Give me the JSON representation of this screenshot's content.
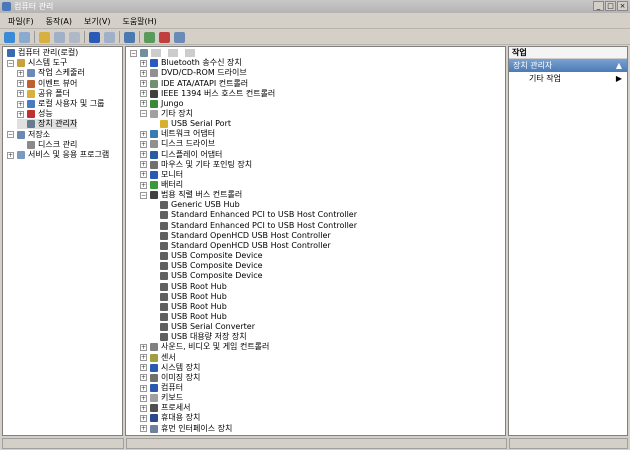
{
  "window": {
    "title": "컴퓨터 관리",
    "controls": [
      "_",
      "□",
      "×"
    ]
  },
  "menu": [
    "파일(F)",
    "동작(A)",
    "보기(V)",
    "도움말(H)"
  ],
  "left_tree": [
    {
      "label": "컴퓨터 관리(로컬)",
      "level": 0,
      "exp": "",
      "color": "#3a6ab0"
    },
    {
      "label": "시스템 도구",
      "level": 1,
      "exp": "−",
      "color": "#c8a040"
    },
    {
      "label": "작업 스케줄러",
      "level": 2,
      "exp": "+",
      "color": "#6a8ab8"
    },
    {
      "label": "이벤트 뷰어",
      "level": 2,
      "exp": "+",
      "color": "#c06030"
    },
    {
      "label": "공유 폴더",
      "level": 2,
      "exp": "+",
      "color": "#d8b040"
    },
    {
      "label": "로컬 사용자 및 그룹",
      "level": 2,
      "exp": "+",
      "color": "#4a7ac0"
    },
    {
      "label": "성능",
      "level": 2,
      "exp": "+",
      "color": "#c03030"
    },
    {
      "label": "장치 관리자",
      "level": 2,
      "exp": "",
      "color": "#6a7a90",
      "selected": true
    },
    {
      "label": "저장소",
      "level": 1,
      "exp": "−",
      "color": "#6a8ab0"
    },
    {
      "label": "디스크 관리",
      "level": 2,
      "exp": "",
      "color": "#8a8a8a"
    },
    {
      "label": "서비스 및 응용 프로그램",
      "level": 1,
      "exp": "+",
      "color": "#7a9ac0"
    }
  ],
  "device_tree": [
    {
      "label": "Bluetooth 송수신 장치",
      "level": 1,
      "exp": "+",
      "color": "#2a5ac0"
    },
    {
      "label": "DVD/CD-ROM 드라이브",
      "level": 1,
      "exp": "+",
      "color": "#909090"
    },
    {
      "label": "IDE ATA/ATAPI 컨트롤러",
      "level": 1,
      "exp": "+",
      "color": "#709070"
    },
    {
      "label": "IEEE 1394 버스 호스트 컨트롤러",
      "level": 1,
      "exp": "+",
      "color": "#404040"
    },
    {
      "label": "Jungo",
      "level": 1,
      "exp": "+",
      "color": "#3a8a3a"
    },
    {
      "label": "기타 장치",
      "level": 1,
      "exp": "−",
      "color": "#a0a0a0"
    },
    {
      "label": "USB Serial Port",
      "level": 2,
      "exp": "",
      "color": "#d8b030"
    },
    {
      "label": "네트워크 어댑터",
      "level": 1,
      "exp": "+",
      "color": "#3a7ab0"
    },
    {
      "label": "디스크 드라이브",
      "level": 1,
      "exp": "+",
      "color": "#909090"
    },
    {
      "label": "디스플레이 어댑터",
      "level": 1,
      "exp": "+",
      "color": "#2a5aa0"
    },
    {
      "label": "마우스 및 기타 포인팅 장치",
      "level": 1,
      "exp": "+",
      "color": "#707070"
    },
    {
      "label": "모니터",
      "level": 1,
      "exp": "+",
      "color": "#2a5ab0"
    },
    {
      "label": "배터리",
      "level": 1,
      "exp": "+",
      "color": "#3a9a3a"
    },
    {
      "label": "범용 직렬 버스 컨트롤러",
      "level": 1,
      "exp": "−",
      "color": "#404040"
    },
    {
      "label": "Generic USB Hub",
      "level": 2,
      "exp": "",
      "color": "#606060"
    },
    {
      "label": "Standard Enhanced PCI to USB Host Controller",
      "level": 2,
      "exp": "",
      "color": "#606060"
    },
    {
      "label": "Standard Enhanced PCI to USB Host Controller",
      "level": 2,
      "exp": "",
      "color": "#606060"
    },
    {
      "label": "Standard OpenHCD USB Host Controller",
      "level": 2,
      "exp": "",
      "color": "#606060"
    },
    {
      "label": "Standard OpenHCD USB Host Controller",
      "level": 2,
      "exp": "",
      "color": "#606060"
    },
    {
      "label": "USB Composite Device",
      "level": 2,
      "exp": "",
      "color": "#606060"
    },
    {
      "label": "USB Composite Device",
      "level": 2,
      "exp": "",
      "color": "#606060"
    },
    {
      "label": "USB Composite Device",
      "level": 2,
      "exp": "",
      "color": "#606060"
    },
    {
      "label": "USB Root Hub",
      "level": 2,
      "exp": "",
      "color": "#606060"
    },
    {
      "label": "USB Root Hub",
      "level": 2,
      "exp": "",
      "color": "#606060"
    },
    {
      "label": "USB Root Hub",
      "level": 2,
      "exp": "",
      "color": "#606060"
    },
    {
      "label": "USB Root Hub",
      "level": 2,
      "exp": "",
      "color": "#606060"
    },
    {
      "label": "USB Serial Converter",
      "level": 2,
      "exp": "",
      "color": "#606060"
    },
    {
      "label": "USB 대용량 저장 장치",
      "level": 2,
      "exp": "",
      "color": "#606060"
    },
    {
      "label": "사운드, 비디오 및 게임 컨트롤러",
      "level": 1,
      "exp": "+",
      "color": "#808080"
    },
    {
      "label": "센서",
      "level": 1,
      "exp": "+",
      "color": "#a0a040"
    },
    {
      "label": "시스템 장치",
      "level": 1,
      "exp": "+",
      "color": "#2a5ab0"
    },
    {
      "label": "이미징 장치",
      "level": 1,
      "exp": "+",
      "color": "#707070"
    },
    {
      "label": "컴퓨터",
      "level": 1,
      "exp": "+",
      "color": "#2a5ab0"
    },
    {
      "label": "키보드",
      "level": 1,
      "exp": "+",
      "color": "#a0a0a0"
    },
    {
      "label": "프로세서",
      "level": 1,
      "exp": "+",
      "color": "#505050"
    },
    {
      "label": "휴대용 장치",
      "level": 1,
      "exp": "+",
      "color": "#2a4a90"
    },
    {
      "label": "휴먼 인터페이스 장치",
      "level": 1,
      "exp": "+",
      "color": "#7080a0"
    }
  ],
  "actions": {
    "header": "작업",
    "section": "장치 관리자",
    "item": "기타 작업"
  }
}
